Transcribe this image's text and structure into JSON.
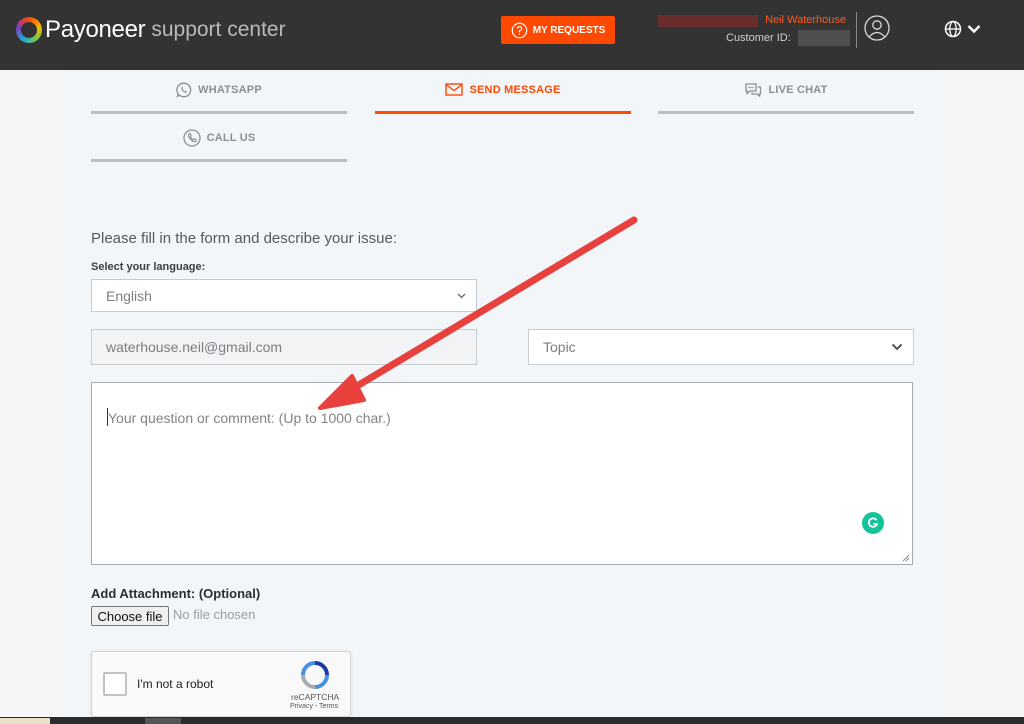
{
  "header": {
    "brand": "Payoneer",
    "subtitle": "support center",
    "my_requests_label": "MY REQUESTS",
    "user_name": "Neil Waterhouse",
    "customer_id_label": "Customer ID:",
    "colors": {
      "bar": "#333333",
      "accent": "#ff4800"
    },
    "icons": [
      "question-circle-icon",
      "user-circle-icon",
      "globe-icon",
      "chevron-down-icon"
    ]
  },
  "tabs": [
    {
      "label": "WHATSAPP",
      "icon": "whatsapp-icon",
      "active": false
    },
    {
      "label": "SEND MESSAGE",
      "icon": "envelope-icon",
      "active": true
    },
    {
      "label": "LIVE CHAT",
      "icon": "chat-bubbles-icon",
      "active": false
    },
    {
      "label": "CALL US",
      "icon": "phone-icon",
      "active": false
    }
  ],
  "form": {
    "intro": "Please fill in the form and describe your issue:",
    "language_label": "Select your language:",
    "language_value": "English",
    "email_value": "waterhouse.neil@gmail.com",
    "topic_placeholder": "Topic",
    "comment_placeholder": "Your question or comment: (Up to 1000 char.)",
    "attachment_label": "Add Attachment: (Optional)",
    "choose_file_label": "Choose file",
    "no_file_text": "No file chosen"
  },
  "recaptcha": {
    "label": "I'm not a robot",
    "brand": "reCAPTCHA",
    "terms": "Privacy - Terms"
  },
  "annotation": {
    "arrow_color": "#e8403d"
  }
}
